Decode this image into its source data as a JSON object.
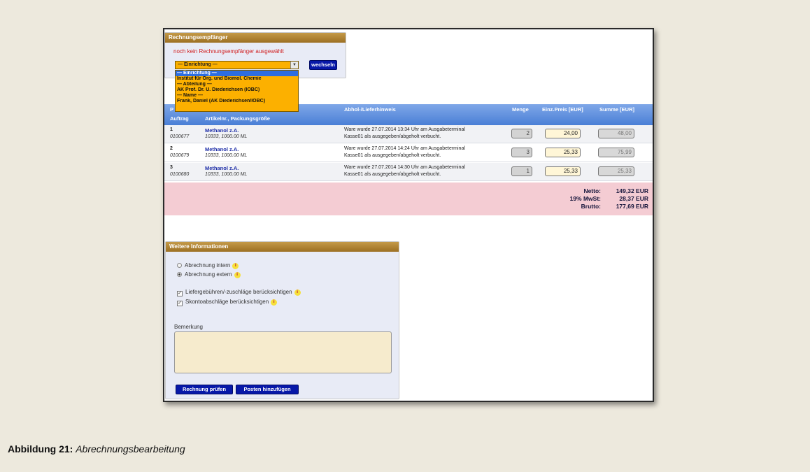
{
  "recipient_panel": {
    "title": "Rechnungsempfänger",
    "no_recipient": "noch kein Rechnungsempfänger ausgewählt",
    "select_value": "— Einrichtung —",
    "change_button": "wechseln",
    "dropdown_options": [
      "— Einrichtung —",
      "Institut für Org. und Biomol. Chemie",
      "— Abteilung —",
      "AK Prof. Dr. U. Diederichsen (IOBC)",
      "— Name —",
      "Frank, Daniel (AK Diederichsen/IOBC)"
    ]
  },
  "table": {
    "headers": {
      "pos": "P",
      "auftrag": "Auftrag",
      "artikel": "Artikelnr., Packungsgröße",
      "hinweis": "Abhol-/Lieferhinweis",
      "menge": "Menge",
      "einzelpreis": "Einz.Preis [EUR]",
      "summe": "Summe [EUR]"
    },
    "rows": [
      {
        "pos": "1",
        "order": "0100677",
        "article": "Methanol z.A.",
        "article_no": "10333, 1000.00 ML",
        "note1": "Ware wurde 27.07.2014 13:34 Uhr am Ausgabeterminal",
        "note2": "Kasse01 als ausgegeben/abgeholt verbucht.",
        "qty": "2",
        "price": "24,00",
        "sum": "48,00"
      },
      {
        "pos": "2",
        "order": "0100679",
        "article": "Methanol z.A.",
        "article_no": "10333, 1000.00 ML",
        "note1": "Ware wurde 27.07.2014 14:24 Uhr am Ausgabeterminal",
        "note2": "Kasse01 als ausgegeben/abgeholt verbucht.",
        "qty": "3",
        "price": "25,33",
        "sum": "75,99"
      },
      {
        "pos": "3",
        "order": "0100680",
        "article": "Methanol z.A.",
        "article_no": "10333, 1000.00 ML",
        "note1": "Ware wurde 27.07.2014 14:30 Uhr am Ausgabeterminal",
        "note2": "Kasse01 als ausgegeben/abgeholt verbucht.",
        "qty": "1",
        "price": "25,33",
        "sum": "25,33"
      }
    ]
  },
  "totals": {
    "netto_label": "Netto:",
    "netto_value": "149,32 EUR",
    "mwst_label": "19% MwSt:",
    "mwst_value": "28,37 EUR",
    "brutto_label": "Brutto:",
    "brutto_value": "177,69 EUR"
  },
  "info_panel": {
    "title": "Weitere Informationen",
    "radio_intern": "Abrechnung intern",
    "radio_extern": "Abrechnung extern",
    "check_fees": "Liefergebühren/-zuschläge berücksichtigen",
    "check_discount": "Skontoabschläge berücksichtigen",
    "remark_label": "Bemerkung",
    "button_check": "Rechnung prüfen",
    "button_add": "Posten hinzufügen"
  },
  "caption": {
    "label": "Abbildung 21:",
    "text": "Abrechnungsbearbeitung"
  }
}
